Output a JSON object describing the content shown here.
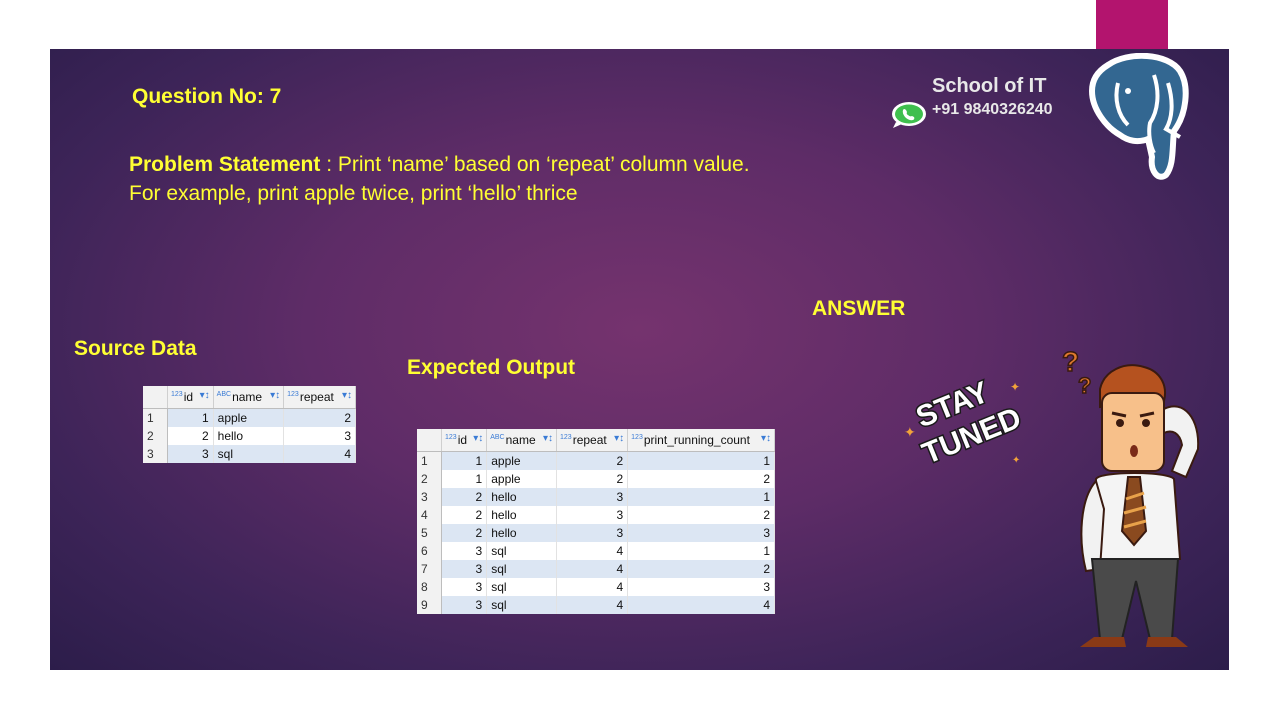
{
  "question": "Question No: 7",
  "problem": {
    "label": "Problem Statement",
    "text": " : Print ‘name’ based on ‘repeat’  column value.",
    "line2": "For example, print apple twice, print ‘hello’ thrice"
  },
  "brand": {
    "name": "School of IT",
    "phone": "+91 9840326240"
  },
  "answer_label": "ANSWER",
  "source_label": "Source Data",
  "expected_label": "Expected Output",
  "sticker_text": [
    "STAY",
    "TUNED"
  ],
  "source_table": {
    "columns": [
      {
        "type": "123",
        "name": "id"
      },
      {
        "type": "ABC",
        "name": "name"
      },
      {
        "type": "123",
        "name": "repeat"
      }
    ],
    "rows": [
      [
        "1",
        "1",
        "apple",
        "2"
      ],
      [
        "2",
        "2",
        "hello",
        "3"
      ],
      [
        "3",
        "3",
        "sql",
        "4"
      ]
    ]
  },
  "output_table": {
    "columns": [
      {
        "type": "123",
        "name": "id"
      },
      {
        "type": "ABC",
        "name": "name"
      },
      {
        "type": "123",
        "name": "repeat"
      },
      {
        "type": "123",
        "name": "print_running_count"
      }
    ],
    "rows": [
      [
        "1",
        "1",
        "apple",
        "2",
        "1"
      ],
      [
        "2",
        "1",
        "apple",
        "2",
        "2"
      ],
      [
        "3",
        "2",
        "hello",
        "3",
        "1"
      ],
      [
        "4",
        "2",
        "hello",
        "3",
        "2"
      ],
      [
        "5",
        "2",
        "hello",
        "3",
        "3"
      ],
      [
        "6",
        "3",
        "sql",
        "4",
        "1"
      ],
      [
        "7",
        "3",
        "sql",
        "4",
        "2"
      ],
      [
        "8",
        "3",
        "sql",
        "4",
        "3"
      ],
      [
        "9",
        "3",
        "sql",
        "4",
        "4"
      ]
    ]
  },
  "colors": {
    "accent_text": "#ffff33",
    "brand_pink": "#b3146e",
    "row_alt": "#dce6f3"
  },
  "icons": [
    "whatsapp-icon",
    "postgresql-elephant-icon",
    "filter-sort-icon",
    "thinking-man-illustration",
    "stay-tuned-sticker"
  ]
}
